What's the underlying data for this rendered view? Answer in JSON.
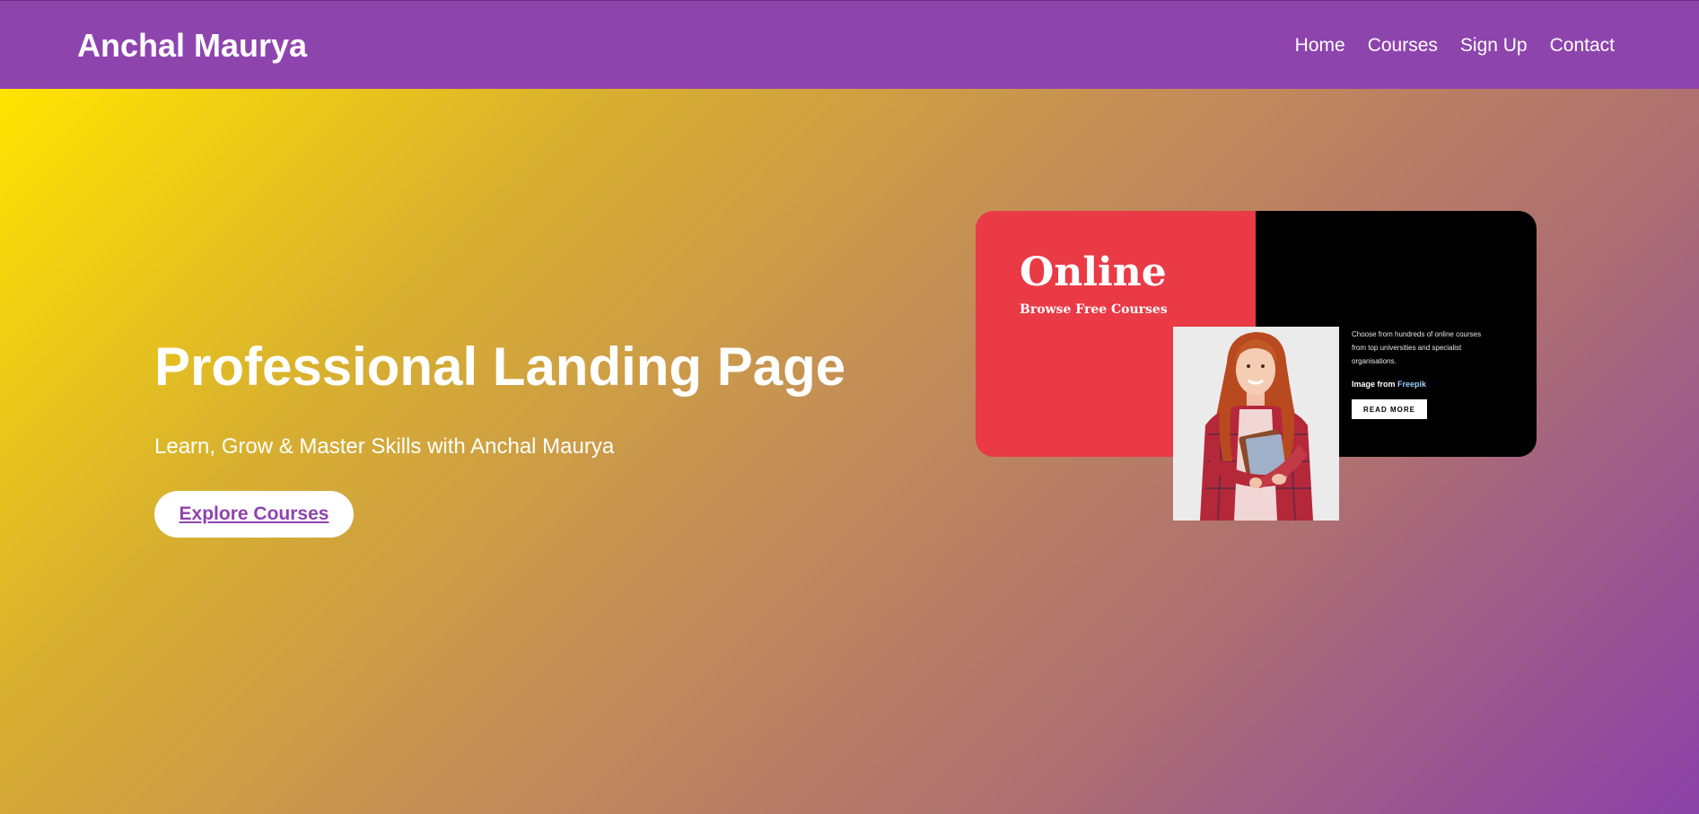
{
  "navbar": {
    "brand": "Anchal Maurya",
    "links": [
      "Home",
      "Courses",
      "Sign Up",
      "Contact"
    ]
  },
  "hero": {
    "title": "Professional Landing Page",
    "subtitle": "Learn, Grow & Master Skills with Anchal Maurya",
    "cta_label": "Explore Courses"
  },
  "banner": {
    "title": "Online",
    "subtitle": "Browse Free Courses",
    "description": "Choose from hundreds of online courses from top universities and specialist organisations.",
    "credit_prefix": "Image from",
    "credit_link": "Freepik",
    "read_more_label": "READ MORE"
  },
  "colors": {
    "nav_bg": "#8e44ad",
    "accent": "#8e44ad",
    "banner_red": "#e93a46",
    "banner_black": "#000000"
  }
}
